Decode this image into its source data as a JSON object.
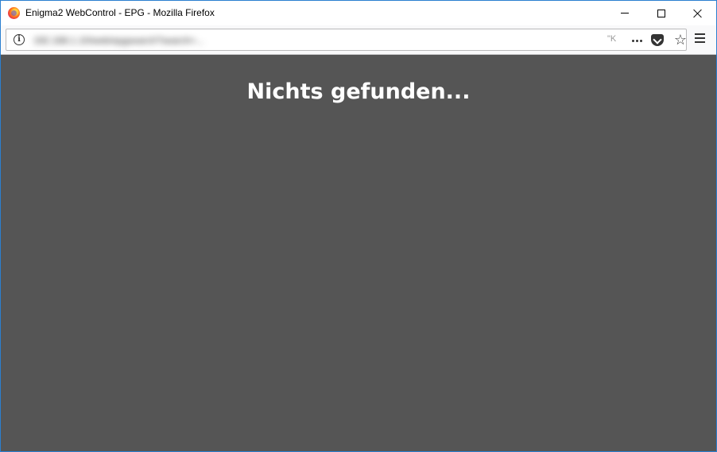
{
  "window": {
    "title": "Enigma2 WebControl - EPG - Mozilla Firefox",
    "accent": "#2b7fd0"
  },
  "browser": {
    "url_display": "192.168.1.10/web/epgsearch?search=...",
    "url_trailing_fragment": "\"K",
    "icons": [
      "firefox-logo-icon",
      "info-icon",
      "page-actions-icon",
      "pocket-icon",
      "star-icon",
      "menu-icon",
      "minimize-icon",
      "maximize-icon",
      "close-icon"
    ]
  },
  "page": {
    "message": "Nichts gefunden...",
    "background_color": "#555555",
    "text_color": "#ffffff"
  }
}
